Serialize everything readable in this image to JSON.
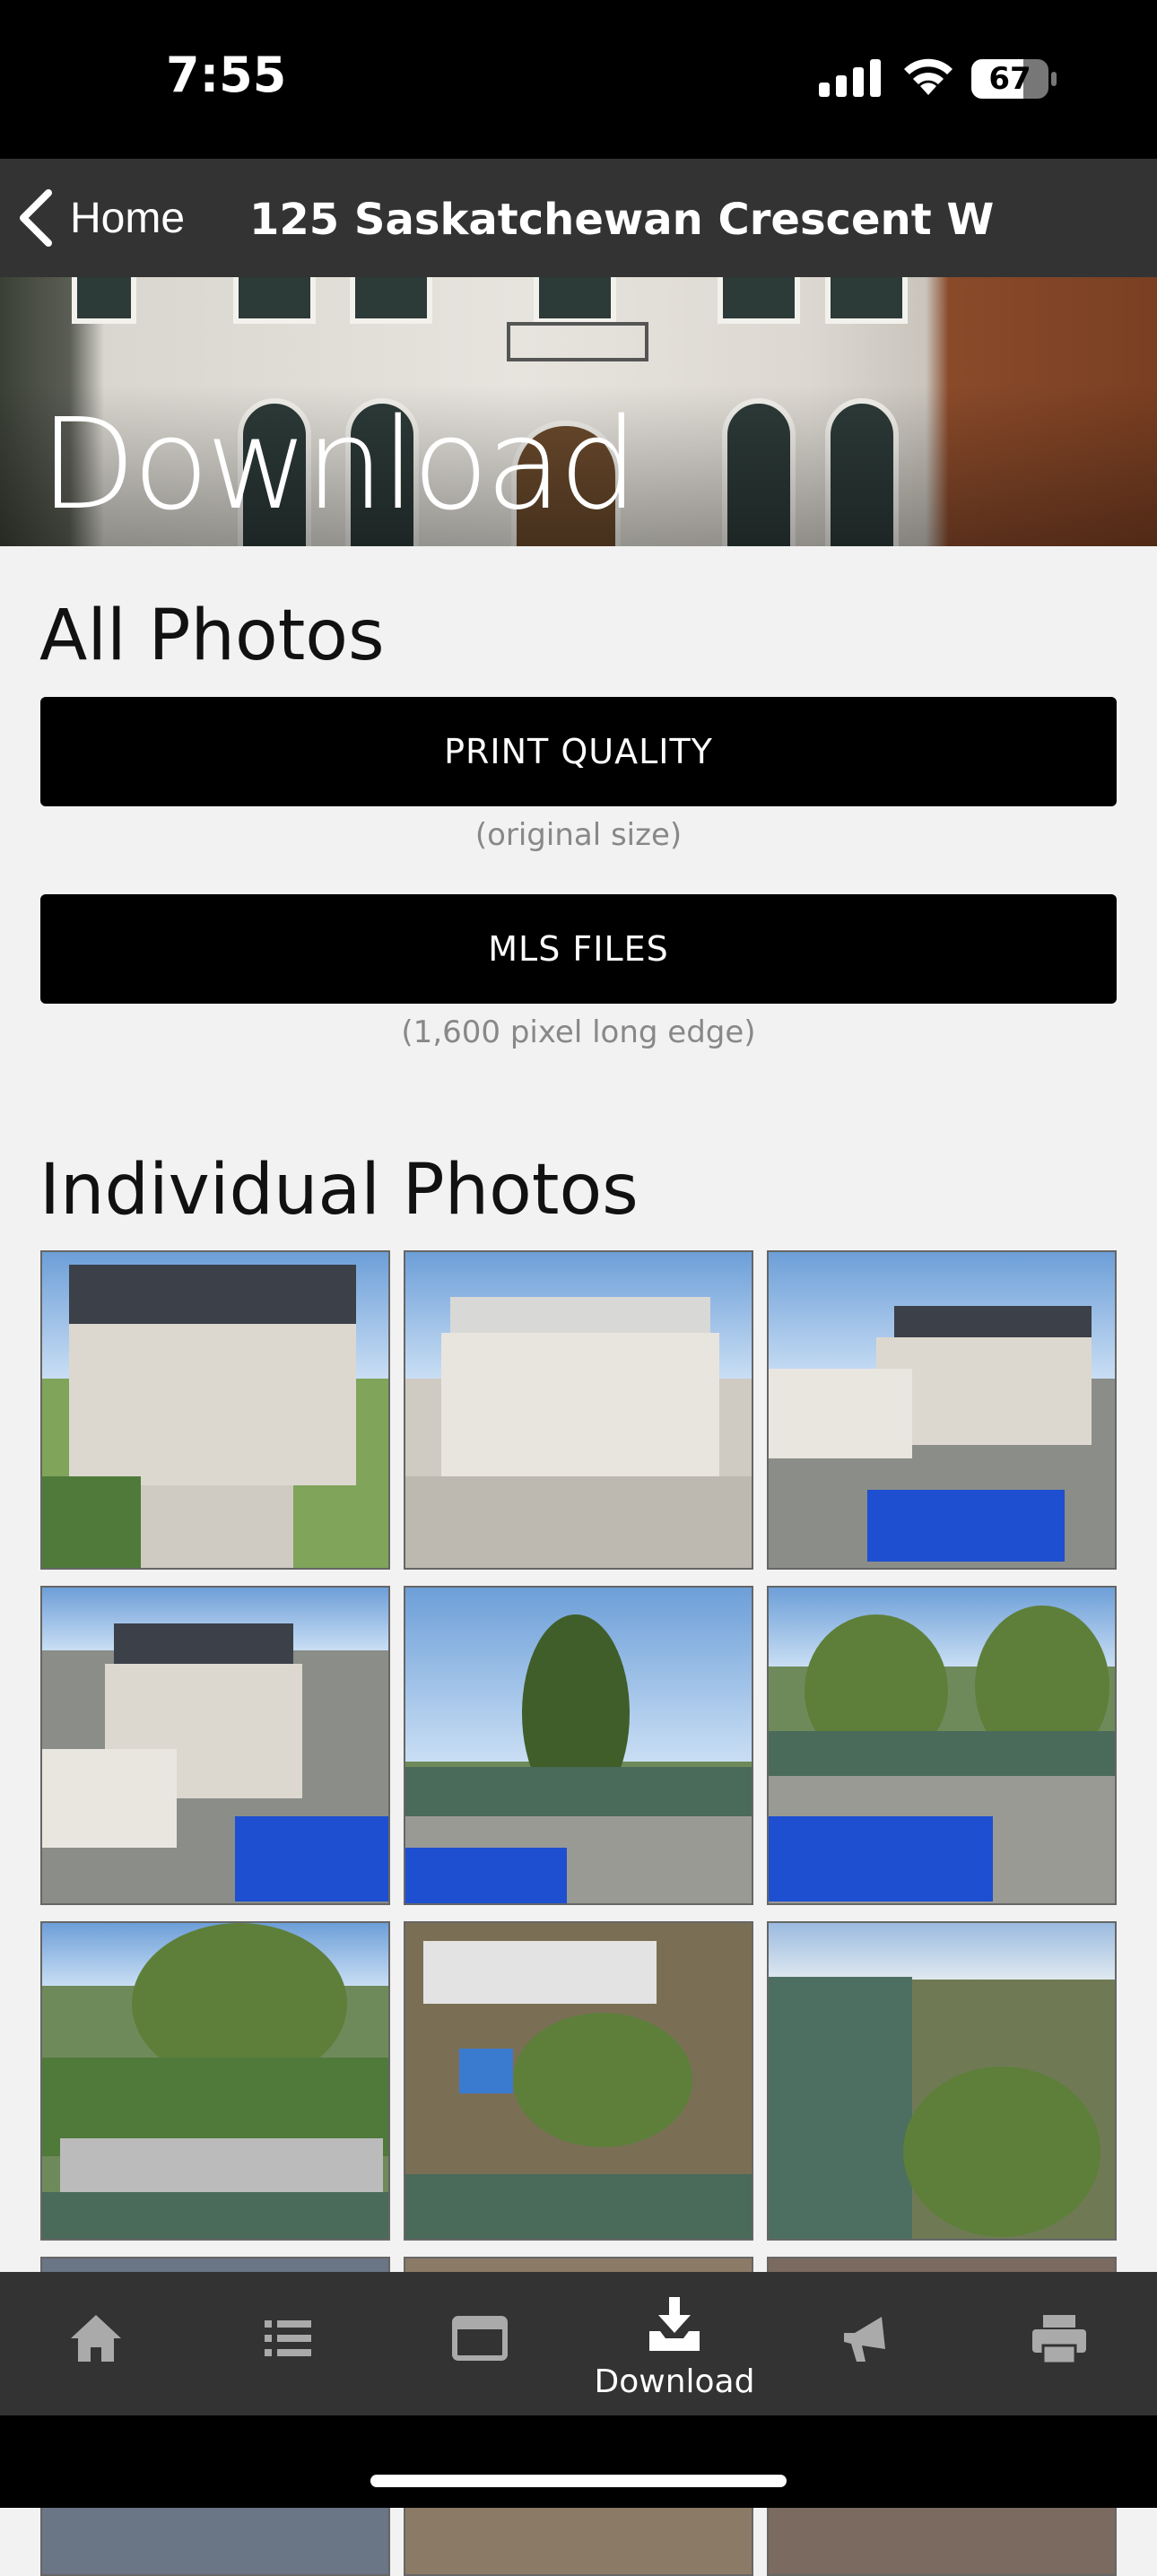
{
  "status_bar": {
    "time": "7:55",
    "battery": "67",
    "battery_level": 0.67
  },
  "nav": {
    "back_label": "Home",
    "title": "125 Saskatchewan Crescent W"
  },
  "hero": {
    "title": "Download"
  },
  "all_photos": {
    "heading": "All Photos",
    "print_button": "PRINT QUALITY",
    "print_caption": "(original size)",
    "mls_button": "MLS FILES",
    "mls_caption": "(1,600 pixel long edge)"
  },
  "individual": {
    "heading": "Individual Photos",
    "photos": [
      "house-front-angle",
      "house-front-straight",
      "backyard-pool-house",
      "backyard-pool-side",
      "pool-river-trees",
      "pool-river-view",
      "aerial-riverbank",
      "aerial-property",
      "aerial-river-city"
    ]
  },
  "tabs": [
    {
      "icon": "home-icon",
      "label": ""
    },
    {
      "icon": "list-icon",
      "label": ""
    },
    {
      "icon": "browser-icon",
      "label": ""
    },
    {
      "icon": "download-icon",
      "label": "Download",
      "active": true
    },
    {
      "icon": "megaphone-icon",
      "label": ""
    },
    {
      "icon": "printer-icon",
      "label": ""
    }
  ]
}
